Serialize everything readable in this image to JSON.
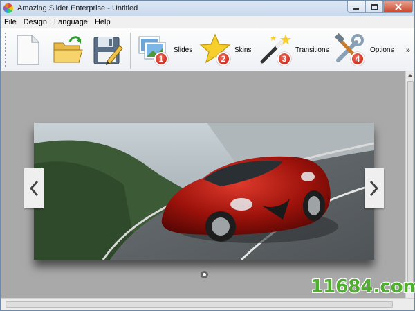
{
  "window": {
    "title": "Amazing Slider Enterprise - Untitled"
  },
  "menu": [
    "File",
    "Design",
    "Language",
    "Help"
  ],
  "toolbar": {
    "slides_label": "Slides",
    "skins_label": "Skins",
    "transitions_label": "Transitions",
    "options_label": "Options",
    "badges": [
      "1",
      "2",
      "3",
      "4"
    ],
    "overflow": "»"
  },
  "preview": {
    "slide_image": "red-sports-car-on-mountain-road",
    "bullet_count": 1
  },
  "watermark": "11684.com",
  "colors": {
    "canvas_bg": "#a9a9a9",
    "badge_red": "#d9291a",
    "watermark_green": "#4fae2e"
  }
}
